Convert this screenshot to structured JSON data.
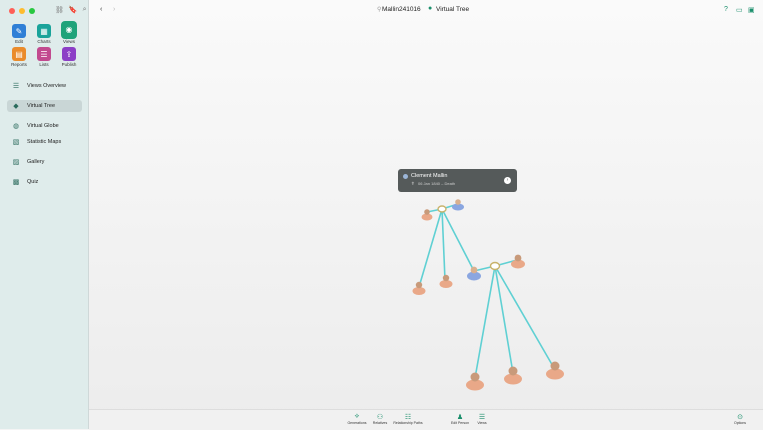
{
  "window": {
    "document_title": "Mallin241016",
    "view_title": "Virtual Tree",
    "traffic_lights": [
      "#ff5f57",
      "#febc2e",
      "#28c840"
    ]
  },
  "toolbar": {
    "tiles": [
      {
        "label": "Edit",
        "icon": "pencil-icon",
        "color": "#2f7fd6"
      },
      {
        "label": "Charts",
        "icon": "chart-icon",
        "color": "#1aa39a"
      },
      {
        "label": "Views",
        "icon": "eye-icon",
        "color": "#1fa37a"
      },
      {
        "label": "Reports",
        "icon": "report-icon",
        "color": "#ea8b2b"
      },
      {
        "label": "Lists",
        "icon": "list-icon",
        "color": "#c24a8f"
      },
      {
        "label": "Publish",
        "icon": "upload-icon",
        "color": "#8c3fc6"
      }
    ]
  },
  "sidebar": {
    "items": [
      {
        "label": "Views Overview",
        "icon": "list-icon"
      },
      {
        "label": "Virtual Tree",
        "icon": "tree-icon",
        "active": true
      },
      {
        "label": "Virtual Globe",
        "icon": "globe-icon"
      },
      {
        "label": "Statistic Maps",
        "icon": "map-icon"
      },
      {
        "label": "Gallery",
        "icon": "gallery-icon"
      },
      {
        "label": "Quiz",
        "icon": "quiz-icon"
      }
    ]
  },
  "popup": {
    "name": "Clement Mallin",
    "life": "06 Jan 1840 – Death"
  },
  "bottom_bar": {
    "buttons": [
      {
        "label": "Generations",
        "icon": "generations-icon"
      },
      {
        "label": "Relatives",
        "icon": "relatives-icon"
      },
      {
        "label": "Relationship Paths",
        "icon": "paths-icon"
      },
      {
        "label": "Edit Person",
        "icon": "person-icon"
      },
      {
        "label": "Views",
        "icon": "views-icon"
      },
      {
        "label": "Options",
        "icon": "options-icon"
      }
    ]
  },
  "colors": {
    "accent": "#1b8f6c",
    "tree_line": "#5fd0d3",
    "female_figure": "#e9a888",
    "male_figure": "#8aa6e0",
    "ring": "#c8b26a"
  }
}
